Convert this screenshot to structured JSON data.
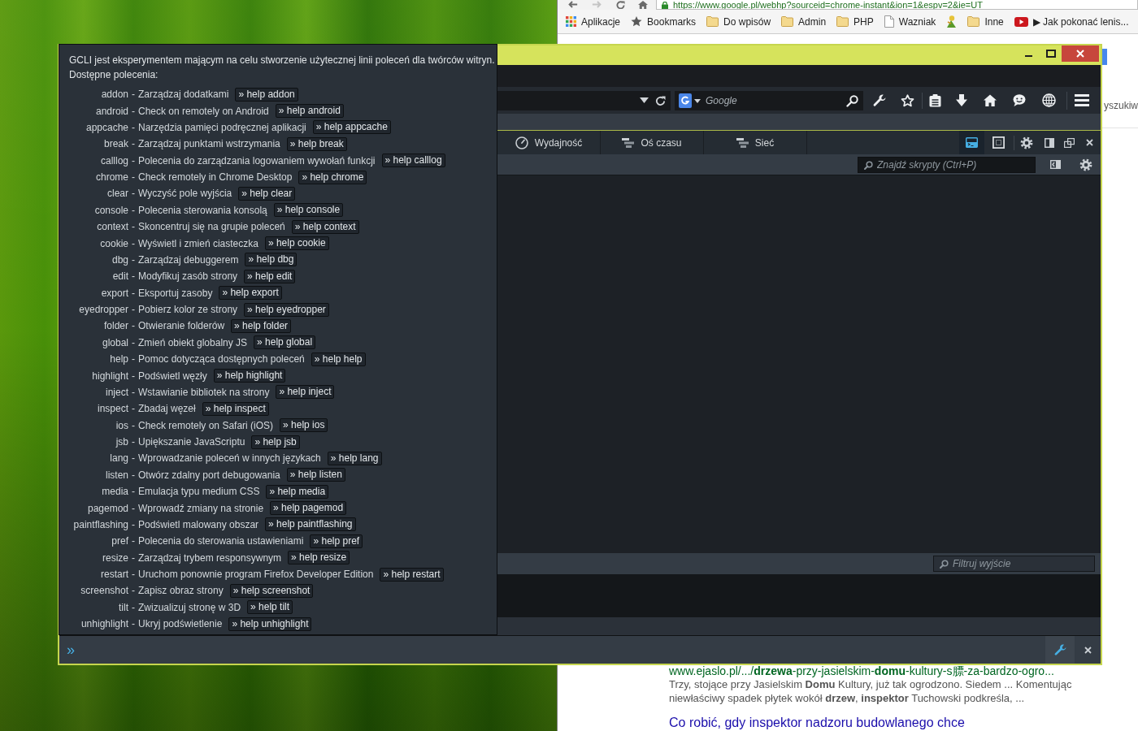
{
  "chrome_window": {
    "address": "https://www.google.pl/webhp?sourceid=chrome-instant&ion=1&espv=2&ie=UT",
    "bookmarks": [
      {
        "kind": "apps",
        "label": "Aplikacje"
      },
      {
        "kind": "star",
        "label": "Bookmarks"
      },
      {
        "kind": "folder",
        "label": "Do wpisów"
      },
      {
        "kind": "folder",
        "label": "Admin"
      },
      {
        "kind": "folder",
        "label": "PHP"
      },
      {
        "kind": "page",
        "label": "Wazniak"
      },
      {
        "kind": "favicon"
      },
      {
        "kind": "folder",
        "label": "Inne"
      },
      {
        "kind": "video",
        "label": "▶ Jak pokonać lenis..."
      }
    ],
    "page_fragment": "yszukiw",
    "search_result": {
      "url": "www.ejaslo.pl/.../**drzewa**-przy-jasielskim-**domu**-kultury-s膘-za-bardzo-ogro...",
      "snippet": "Trzy, stojące przy Jasielskim **Domu** Kultury, już tak ogrodzono. Siedem ... Komentując niewłaściwy spadek płytek wokół **drzew**, **inspektor** Tuchowski podkreśla, ...",
      "next_title": "Co robić, gdy inspektor nadzoru budowlanego chce"
    }
  },
  "firefox_window": {
    "search": {
      "placeholder": "Google"
    },
    "devtools": {
      "tabs": [
        {
          "kind": "performance",
          "label": "Wydajność",
          "selected": false
        },
        {
          "kind": "timeline",
          "label": "Oś czasu",
          "selected": false
        },
        {
          "kind": "network",
          "label": "Sieć",
          "selected": false
        }
      ],
      "toolbox_buttons": [
        {
          "kind": "split_console",
          "on": true
        },
        {
          "kind": "frame_picker",
          "on": false
        }
      ],
      "script_search": {
        "placeholder": "Znajdź skrypty (Ctrl+P)"
      },
      "output_filter": {
        "placeholder": "Filtruj wyjście"
      },
      "command_line": {
        "prompt": "»"
      }
    },
    "gcli_help": {
      "intro": "GCLI jest eksperymentem mającym na celu stworzenie użytecznej linii poleceń dla twórców witryn.",
      "heading": "Dostępne polecenia:",
      "commands": [
        {
          "name": "addon",
          "separator": "-",
          "description": "Zarządzaj dodatkami",
          "help": "» help addon"
        },
        {
          "name": "android",
          "separator": "-",
          "description": "Check on remotely on Android",
          "help": "» help android"
        },
        {
          "name": "appcache",
          "separator": "-",
          "description": "Narzędzia pamięci podręcznej aplikacji",
          "help": "» help appcache"
        },
        {
          "name": "break",
          "separator": "-",
          "description": "Zarządzaj punktami wstrzymania",
          "help": "» help break"
        },
        {
          "name": "calllog",
          "separator": "-",
          "description": "Polecenia do zarządzania logowaniem wywołań funkcji",
          "help": "» help calllog"
        },
        {
          "name": "chrome",
          "separator": "-",
          "description": "Check remotely in Chrome Desktop",
          "help": "» help chrome"
        },
        {
          "name": "clear",
          "separator": "-",
          "description": "Wyczyść pole wyjścia",
          "help": "» help clear"
        },
        {
          "name": "console",
          "separator": "-",
          "description": "Polecenia sterowania konsolą",
          "help": "» help console"
        },
        {
          "name": "context",
          "separator": "-",
          "description": "Skoncentruj się na grupie poleceń",
          "help": "» help context"
        },
        {
          "name": "cookie",
          "separator": "-",
          "description": "Wyświetl i zmień ciasteczka",
          "help": "» help cookie"
        },
        {
          "name": "dbg",
          "separator": "-",
          "description": "Zarządzaj debuggerem",
          "help": "» help dbg"
        },
        {
          "name": "edit",
          "separator": "-",
          "description": "Modyfikuj zasób strony",
          "help": "» help edit"
        },
        {
          "name": "export",
          "separator": "-",
          "description": "Eksportuj zasoby",
          "help": "» help export"
        },
        {
          "name": "eyedropper",
          "separator": "-",
          "description": "Pobierz kolor ze strony",
          "help": "» help eyedropper"
        },
        {
          "name": "folder",
          "separator": "-",
          "description": "Otwieranie folderów",
          "help": "» help folder"
        },
        {
          "name": "global",
          "separator": "-",
          "description": "Zmień obiekt globalny JS",
          "help": "» help global"
        },
        {
          "name": "help",
          "separator": "-",
          "description": "Pomoc dotycząca dostępnych poleceń",
          "help": "» help help"
        },
        {
          "name": "highlight",
          "separator": "-",
          "description": "Podświetl węzły",
          "help": "» help highlight"
        },
        {
          "name": "inject",
          "separator": "-",
          "description": "Wstawianie bibliotek na strony",
          "help": "» help inject"
        },
        {
          "name": "inspect",
          "separator": "-",
          "description": "Zbadaj węzeł",
          "help": "» help inspect"
        },
        {
          "name": "ios",
          "separator": "-",
          "description": "Check remotely on Safari (iOS)",
          "help": "» help ios"
        },
        {
          "name": "jsb",
          "separator": "-",
          "description": "Upiększanie JavaScriptu",
          "help": "» help jsb"
        },
        {
          "name": "lang",
          "separator": "-",
          "description": "Wprowadzanie poleceń w innych językach",
          "help": "» help lang"
        },
        {
          "name": "listen",
          "separator": "-",
          "description": "Otwórz zdalny port debugowania",
          "help": "» help listen"
        },
        {
          "name": "media",
          "separator": "-",
          "description": "Emulacja typu medium CSS",
          "help": "» help media"
        },
        {
          "name": "pagemod",
          "separator": "-",
          "description": "Wprowadź zmiany na stronie",
          "help": "» help pagemod"
        },
        {
          "name": "paintflashing",
          "separator": "-",
          "description": "Podświetl malowany obszar",
          "help": "» help paintflashing"
        },
        {
          "name": "pref",
          "separator": "-",
          "description": "Polecenia do sterowania ustawieniami",
          "help": "» help pref"
        },
        {
          "name": "resize",
          "separator": "-",
          "description": "Zarządzaj trybem responsywnym",
          "help": "» help resize"
        },
        {
          "name": "restart",
          "separator": "-",
          "description": "Uruchom ponownie program Firefox Developer Edition",
          "help": "» help restart"
        },
        {
          "name": "screenshot",
          "separator": "-",
          "description": "Zapisz obraz strony",
          "help": "» help screenshot"
        },
        {
          "name": "tilt",
          "separator": "-",
          "description": "Zwizualizuj stronę w 3D",
          "help": "» help tilt"
        },
        {
          "name": "unhighlight",
          "separator": "-",
          "description": "Ukryj podświetlenie",
          "help": "» help unhighlight"
        }
      ]
    }
  }
}
